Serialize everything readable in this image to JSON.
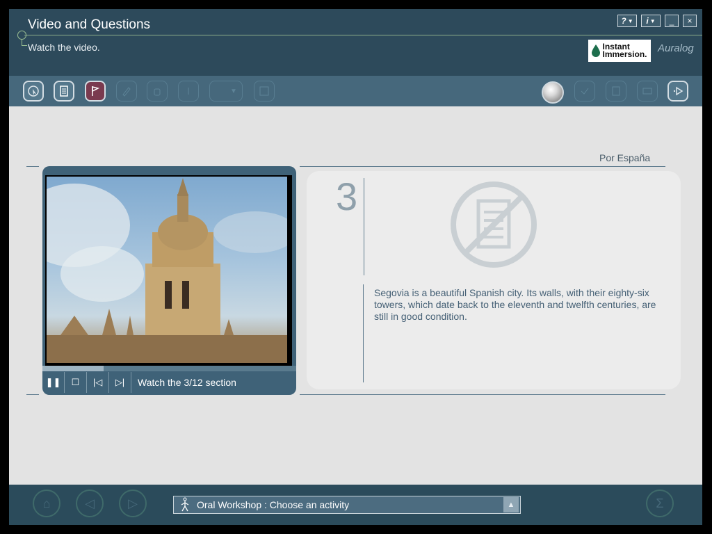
{
  "header": {
    "title": "Video and Questions",
    "subtitle": "Watch the video.",
    "window_buttons": {
      "help": "?",
      "info": "i",
      "minimize": "_",
      "close": "×"
    },
    "logo_instant": "Instant",
    "logo_immersion": "Immersion.",
    "logo_auralog": "Auralog"
  },
  "content": {
    "section_label": "Por España",
    "number": "3",
    "video_status": "Watch the 3/12 section",
    "video_progress": 0.24,
    "description": "Segovia is a beautiful Spanish city. Its walls, with their eighty-six towers, which date back to the eleventh and twelfth centuries, are still in good condition."
  },
  "bottom": {
    "activity_label": "Oral Workshop : Choose an activity"
  },
  "colors": {
    "header": "#2d4a5b",
    "toolbar": "#46687c",
    "background": "#e3e3e3",
    "bottom_bar": "#2b4b5b",
    "text_accent": "#456075"
  }
}
